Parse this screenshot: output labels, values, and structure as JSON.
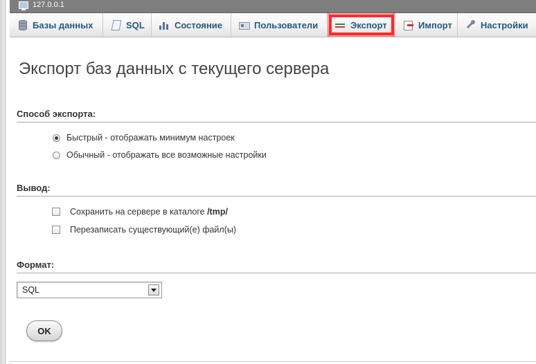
{
  "server_label": "127.0.0.1",
  "tabs": [
    {
      "label": "Базы данных",
      "icon": "database-icon"
    },
    {
      "label": "SQL",
      "icon": "sql-icon"
    },
    {
      "label": "Состояние",
      "icon": "status-icon"
    },
    {
      "label": "Пользователи",
      "icon": "users-icon"
    },
    {
      "label": "Экспорт",
      "icon": "export-icon",
      "active": true,
      "highlight_color": "#ff2a2a"
    },
    {
      "label": "Импорт",
      "icon": "import-icon"
    },
    {
      "label": "Настройки",
      "icon": "settings-icon"
    }
  ],
  "page_title": "Экспорт баз данных с текущего сервера",
  "export_method": {
    "title": "Способ экспорта:",
    "options": [
      {
        "label": "Быстрый - отображать минимум настроек",
        "selected": true
      },
      {
        "label": "Обычный - отображать все возможные настройки",
        "selected": false
      }
    ]
  },
  "output": {
    "title": "Вывод:",
    "save_prefix": "Сохранить на сервере в каталоге",
    "save_dir": "/tmp/",
    "overwrite_label": "Перезаписать существующий(е) файл(ы)"
  },
  "format": {
    "title": "Формат:",
    "selected": "SQL"
  },
  "ok_label": "OK",
  "colors": {
    "tab_text": "#235a81",
    "topbar": "#7e7e7e"
  }
}
